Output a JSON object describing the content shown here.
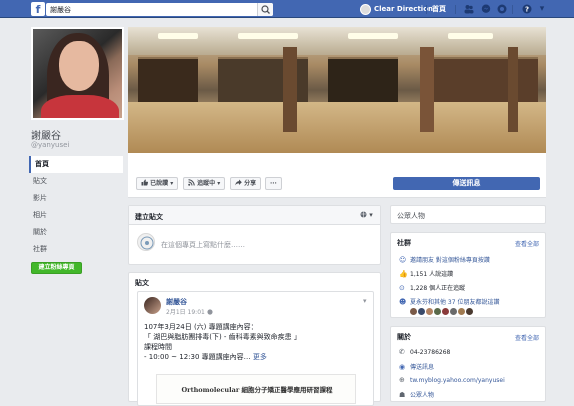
{
  "topbar": {
    "logo": "f",
    "search_value": "謝嚴谷",
    "user_name": "Clear Direction",
    "home": "首頁",
    "icons": [
      "friends-icon",
      "messages-icon",
      "notifications-icon",
      "help-icon",
      "dropdown-icon"
    ]
  },
  "profile": {
    "name": "謝嚴谷",
    "handle": "@yanyusei",
    "nav": [
      "首頁",
      "貼文",
      "影片",
      "相片",
      "關於",
      "社群"
    ],
    "create_page": "建立粉絲專頁"
  },
  "page_actions": {
    "like": "已說讚",
    "follow": "追蹤中",
    "share": "分享",
    "more": "···",
    "send_message": "傳送訊息"
  },
  "create_post": {
    "title": "建立貼文",
    "placeholder": "在這個專頁上寫點什麼……"
  },
  "posts_section": {
    "title": "貼文",
    "author": "謝嚴谷",
    "date": "2月1日 19:01",
    "lines": [
      "107年3月24日 (六) 專題講座內容：",
      "「 湖巴與脂肪團排毒(下) - 齒科毒素與致命疾患 」",
      "課程時間",
      "- 10:00 ~ 12:30 專題講座內容… "
    ],
    "more": "更多",
    "image_text": "Orthomolecular  細胞分子矯正醫學應用研習課程"
  },
  "sidebar": {
    "public_figure": "公眾人物",
    "community": {
      "title": "社群",
      "see_all": "查看全部",
      "rows": [
        {
          "text": "邀請朋友 對這個粉絲專頁按讚",
          "icon": "invite-icon"
        },
        {
          "text": "1,151 人說這讚",
          "icon": "like-icon"
        },
        {
          "text": "1,228 個人正在追蹤",
          "icon": "follow-icon"
        },
        {
          "text": "夏永芬和其他 37 位朋友都說這讚",
          "icon": "friends-like-icon"
        }
      ]
    },
    "about": {
      "title": "關於",
      "see_all": "查看全部",
      "rows": [
        {
          "text": "04-23786268",
          "icon": "phone-icon"
        },
        {
          "text": "傳送訊息",
          "icon": "messenger-icon"
        },
        {
          "text": "tw.myblog.yahoo.com/yanyusei",
          "icon": "globe-icon"
        },
        {
          "text": "公眾人物",
          "icon": "person-icon"
        }
      ]
    }
  },
  "colors": {
    "brand": "#4267b2",
    "green": "#42b72a",
    "bg": "#e9ebee"
  }
}
